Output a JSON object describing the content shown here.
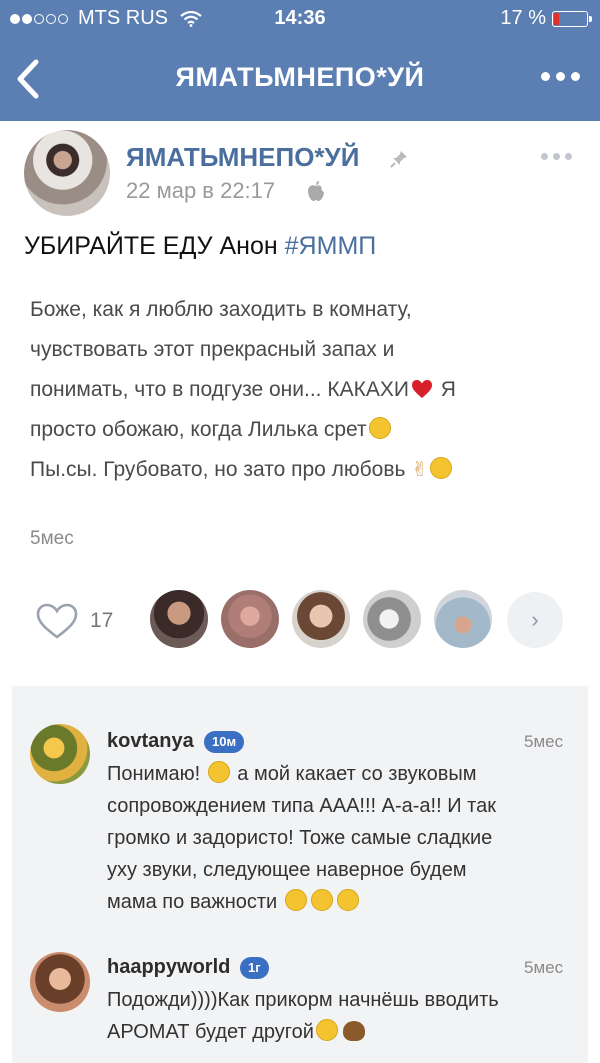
{
  "status_bar": {
    "carrier": "MTS RUS",
    "time": "14:36",
    "battery": "17 %",
    "battery_level": 0.17
  },
  "nav": {
    "title": "ЯМАТЬМНЕПО*УЙ",
    "back_icon": "chevron-left-icon",
    "more_icon": "more-dots-icon"
  },
  "post": {
    "author": "ЯМАТЬМНЕПО*УЙ",
    "date": "22 мар в 22:17",
    "text": "УБИРАЙТЕ ЕДУ Анон ",
    "hashtag": "#ЯММП",
    "quote_lines": [
      "Боже, как я люблю заходить в комнату,",
      "чувствовать этот прекрасный запах и",
      "понимать,  что в подгузе они... КАКАХИ",
      " Я",
      "просто обожаю, когда Лилька срет",
      "Пы.сы. Грубовато, но зато про любовь "
    ],
    "age": "5мес",
    "likes": "17"
  },
  "comments": [
    {
      "author": "kovtanya",
      "badge": "10м",
      "time": "5мес",
      "lines": [
        "Понимаю! ",
        " а мой какает со звуковым",
        "сопровождением типа ААА!!! А-а-а!! И так",
        "громко и задористо! Тоже самые сладкие",
        "уху звуки, следующее наверное будем",
        "мама по важности "
      ]
    },
    {
      "author": "haappyworld",
      "badge": "1г",
      "time": "5мес",
      "lines": [
        "Подожди))))Как прикорм начнёшь вводить",
        "АРОМАТ будет другой"
      ]
    }
  ],
  "colors": {
    "nav_bg": "#5b7fb2",
    "link": "#4a6f9e",
    "badge": "#3a6fc4"
  }
}
